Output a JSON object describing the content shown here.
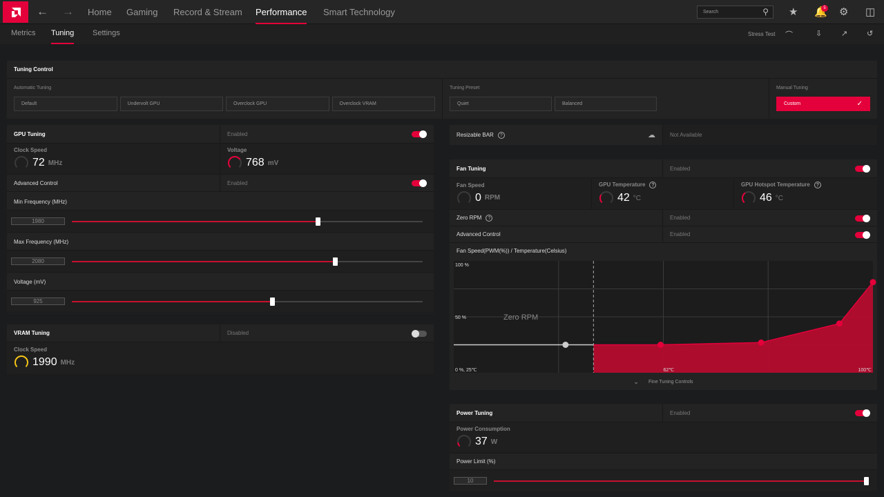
{
  "topnav": {
    "items": [
      "Home",
      "Gaming",
      "Record & Stream",
      "Performance",
      "Smart Technology"
    ],
    "active": "Performance",
    "search_placeholder": "Search",
    "notification_count": "5"
  },
  "subnav": {
    "tabs": [
      "Metrics",
      "Tuning",
      "Settings"
    ],
    "active": "Tuning",
    "stress_test": "Stress Test"
  },
  "tuning_control": {
    "title": "Tuning Control",
    "automatic_label": "Automatic Tuning",
    "automatic_options": [
      "Default",
      "Undervolt GPU",
      "Overclock GPU",
      "Overclock VRAM"
    ],
    "preset_label": "Tuning Preset",
    "preset_options": [
      "Quiet",
      "Balanced"
    ],
    "manual_label": "Manual Tuning",
    "manual_option": "Custom"
  },
  "gpu_tuning": {
    "title": "GPU Tuning",
    "status": "Enabled",
    "clock_label": "Clock Speed",
    "clock_value": "72",
    "clock_unit": "MHz",
    "voltage_label": "Voltage",
    "voltage_value": "768",
    "voltage_unit": "mV",
    "advanced_label": "Advanced Control",
    "advanced_status": "Enabled",
    "sliders": [
      {
        "label": "Min Frequency (MHz)",
        "value": "1980",
        "fill_pct": 70
      },
      {
        "label": "Max Frequency (MHz)",
        "value": "2080",
        "fill_pct": 75
      },
      {
        "label": "Voltage (mV)",
        "value": "925",
        "fill_pct": 57
      }
    ]
  },
  "vram_tuning": {
    "title": "VRAM Tuning",
    "status": "Disabled",
    "clock_label": "Clock Speed",
    "clock_value": "1990",
    "clock_unit": "MHz"
  },
  "resizable_bar": {
    "label": "Resizable BAR",
    "status": "Not Available"
  },
  "fan_tuning": {
    "title": "Fan Tuning",
    "status": "Enabled",
    "fan_speed_label": "Fan Speed",
    "fan_speed_value": "0",
    "fan_speed_unit": "RPM",
    "gpu_temp_label": "GPU Temperature",
    "gpu_temp_value": "42",
    "gpu_temp_unit": "°C",
    "hotspot_label": "GPU Hotspot Temperature",
    "hotspot_value": "46",
    "hotspot_unit": "°C",
    "zero_rpm_label": "Zero RPM",
    "zero_rpm_status": "Enabled",
    "advanced_label": "Advanced Control",
    "advanced_status": "Enabled",
    "chart_title": "Fan Speed(PWM(%)) / Temperature(Celsius)",
    "fine_tuning": "Fine Tuning Controls"
  },
  "chart_data": {
    "type": "area",
    "xlim": [
      25,
      100
    ],
    "ylim": [
      0,
      100
    ],
    "y_tick_labels": [
      "100 %",
      "50 %",
      "0 %, 25℃"
    ],
    "x_tick_labels": [
      "62℃",
      "100℃"
    ],
    "zero_rpm_label": "Zero RPM",
    "zero_rpm_stop_temp": 50,
    "zero_rpm_point": {
      "x": 45,
      "y": 25
    },
    "points": [
      {
        "x": 62,
        "y": 25
      },
      {
        "x": 80,
        "y": 27
      },
      {
        "x": 94,
        "y": 44
      },
      {
        "x": 100,
        "y": 81
      }
    ],
    "fill_color": "#b50c2e",
    "point_color": "#e4003a",
    "grid": true
  },
  "power_tuning": {
    "title": "Power Tuning",
    "status": "Enabled",
    "consumption_label": "Power Consumption",
    "consumption_value": "37",
    "consumption_unit": "W",
    "limit_label": "Power Limit (%)",
    "limit_value": "10",
    "limit_fill_pct": 100
  },
  "colors": {
    "accent": "#e4003a"
  }
}
